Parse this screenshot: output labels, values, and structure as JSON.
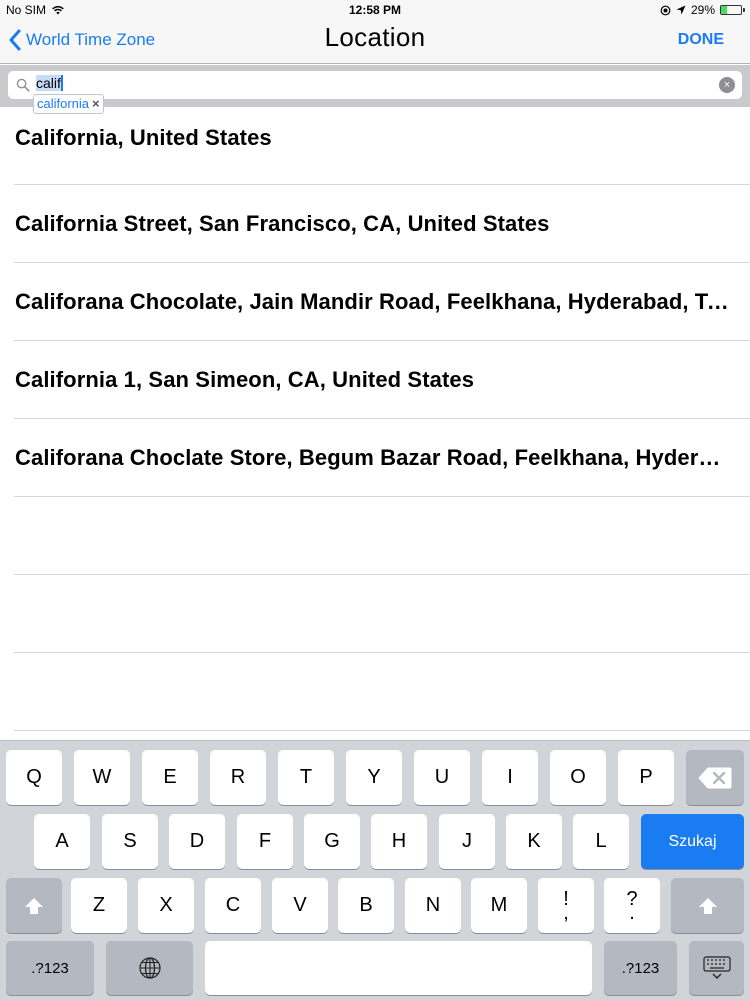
{
  "status_bar": {
    "carrier": "No SIM",
    "time": "12:58 PM",
    "battery_percent": "29%",
    "battery_level": 0.29
  },
  "nav": {
    "back_label": "World Time Zone",
    "title": "Location",
    "done_label": "DONE"
  },
  "search": {
    "query": "calif",
    "suggestion": "california",
    "suggestion_dismiss": "×",
    "clear_glyph": "×"
  },
  "results": [
    "California, United States",
    "California Street, San Francisco, CA, United States",
    "Califorana Chocolate, Jain Mandir Road, Feelkhana, Hyderabad, Telangana, India",
    "California 1, San Simeon, CA, United States",
    "Califorana Choclate Store, Begum Bazar Road, Feelkhana, Hyderabad, Telangana, India"
  ],
  "keyboard": {
    "row1": [
      "Q",
      "W",
      "E",
      "R",
      "T",
      "Y",
      "U",
      "I",
      "O",
      "P"
    ],
    "row2": [
      "A",
      "S",
      "D",
      "F",
      "G",
      "H",
      "J",
      "K",
      "L"
    ],
    "row3": [
      "Z",
      "X",
      "C",
      "V",
      "B",
      "N",
      "M"
    ],
    "punct1": {
      "top": "!",
      "bottom": ","
    },
    "punct2": {
      "top": "?",
      "bottom": "."
    },
    "search_label": "Szukaj",
    "numbers_label": ".?123",
    "icons": [
      "backspace-icon",
      "shift-icon",
      "globe-icon",
      "keyboard-dismiss-icon"
    ],
    "accent_color": "#1a7cf3"
  }
}
